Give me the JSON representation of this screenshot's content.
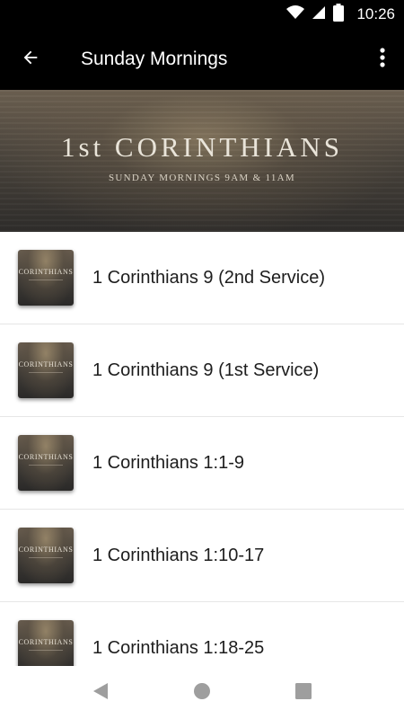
{
  "status_bar": {
    "time": "10:26"
  },
  "app_bar": {
    "title": "Sunday Mornings",
    "back_icon": "arrow-back-icon",
    "menu_icon": "more-vert-icon"
  },
  "banner": {
    "title": "1st CORINTHIANS",
    "subtitle": "SUNDAY MORNINGS 9AM & 11AM"
  },
  "thumbnail_text": "CORINTHIANS",
  "list": {
    "items": [
      {
        "title": "1 Corinthians 9 (2nd Service)"
      },
      {
        "title": "1 Corinthians 9 (1st Service)"
      },
      {
        "title": "1 Corinthians 1:1-9"
      },
      {
        "title": "1 Corinthians 1:10-17"
      },
      {
        "title": "1 Corinthians 1:18-25"
      }
    ]
  },
  "nav_bar": {
    "back_icon": "nav-back-icon",
    "home_icon": "nav-home-icon",
    "recents_icon": "nav-recents-icon"
  }
}
